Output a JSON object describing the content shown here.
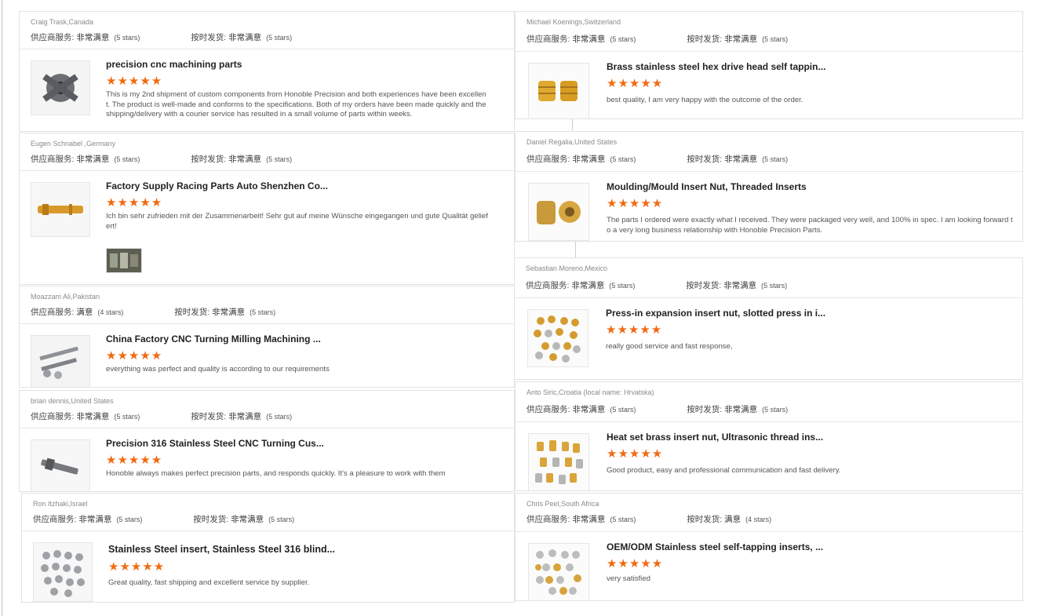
{
  "labels": {
    "service": "供应商服务:",
    "delivery": "按时发货:"
  },
  "colors": {
    "star": "#f16a12",
    "border": "#e3e3e3"
  },
  "reviews": [
    {
      "reviewer": "Craig Trask,Canada",
      "service_value": "非常满意",
      "service_stars": "(5 stars)",
      "delivery_value": "非常满意",
      "delivery_stars": "(5 stars)",
      "title": "precision cnc machining parts",
      "stars": "★★★★★",
      "comment": "This is my 2nd shipment of custom components from Honoble Precision and both experiences have been excellent.  The product is well-made and conforms to the specifications.  Both of my orders have been made quickly and the shipping/delivery with a courier service has resulted in a small volume of parts within weeks.",
      "thumb_icon": "cnc-part-icon"
    },
    {
      "reviewer": "Eugen Schnabel ,Germany",
      "service_value": "非常满意",
      "service_stars": "(5 stars)",
      "delivery_value": "非常满意",
      "delivery_stars": "(5 stars)",
      "title": "Factory Supply Racing Parts Auto Shenzhen Co...",
      "stars": "★★★★★",
      "comment": "Ich bin sehr zufrieden mit der Zusammenarbeit! Sehr gut auf meine Wünsche eingegangen und gute Qualität geliefert!",
      "thumb_icon": "brass-shaft-icon"
    },
    {
      "reviewer": "Moazzam Ali,Pakistan",
      "service_value": "满意",
      "service_stars": "(4 stars)",
      "delivery_value": "非常满意",
      "delivery_stars": "(5 stars)",
      "title": "China Factory CNC Turning Milling Machining ...",
      "stars": "★★★★★",
      "comment": "everything was perfect and quality is according to our requirements",
      "thumb_icon": "bolts-icon"
    },
    {
      "reviewer": "brian dennis,United States",
      "service_value": "非常满意",
      "service_stars": "(5 stars)",
      "delivery_value": "非常满意",
      "delivery_stars": "(5 stars)",
      "title": "Precision 316 Stainless Steel CNC Turning Cus...",
      "stars": "★★★★★",
      "comment": "Honoble always makes perfect precision parts, and responds quickly. It's a pleasure to work with them",
      "thumb_icon": "steel-pin-icon"
    },
    {
      "reviewer": "Ron Itzhaki,Israel",
      "service_value": "非常满意",
      "service_stars": "(5 stars)",
      "delivery_value": "非常满意",
      "delivery_stars": "(5 stars)",
      "title": "Stainless Steel insert, Stainless Steel 316 blind...",
      "stars": "★★★★★",
      "comment": "Great quality, fast shipping and excellent service by supplier.",
      "thumb_icon": "steel-inserts-icon"
    },
    {
      "reviewer": "Michael Koenings,Switzerland",
      "service_value": "非常满意",
      "service_stars": "(5 stars)",
      "delivery_value": "非常满意",
      "delivery_stars": "(5 stars)",
      "title": "Brass stainless steel hex drive head self tappin...",
      "stars": "★★★★★",
      "comment": "best quality, I am very happy with the outcome of the order.",
      "thumb_icon": "brass-insert-icon"
    },
    {
      "reviewer": "Daniel Regalia,United States",
      "service_value": "非常满意",
      "service_stars": "(5 stars)",
      "delivery_value": "非常满意",
      "delivery_stars": "(5 stars)",
      "title": "Moulding/Mould Insert Nut, Threaded Inserts",
      "stars": "★★★★★",
      "comment": "The parts I ordered were exactly what I received.  They were packaged very well, and 100% in spec.  I am looking forward to a very long business relationship with Honoble Precision Parts.",
      "thumb_icon": "threaded-insert-icon"
    },
    {
      "reviewer": "Sebastian Moreno,Mexico",
      "service_value": "非常满意",
      "service_stars": "(5 stars)",
      "delivery_value": "非常满意",
      "delivery_stars": "(5 stars)",
      "title": "Press-in expansion insert nut, slotted press in i...",
      "stars": "★★★★★",
      "comment": "really good service and fast response,",
      "thumb_icon": "insert-nuts-icon"
    },
    {
      "reviewer": "Anto Siric,Croatia (local name: Hrvatska)",
      "service_value": "非常满意",
      "service_stars": "(5 stars)",
      "delivery_value": "非常满意",
      "delivery_stars": "(5 stars)",
      "title": "Heat set brass insert nut, Ultrasonic thread ins...",
      "stars": "★★★★★",
      "comment": "Good product, easy and professional communication and fast delivery.",
      "thumb_icon": "heat-set-insert-icon"
    },
    {
      "reviewer": "Chris Peel,South Africa",
      "service_value": "非常满意",
      "service_stars": "(5 stars)",
      "delivery_value": "满意",
      "delivery_stars": "(4 stars)",
      "title": "OEM/ODM Stainless steel self-tapping inserts, ...",
      "stars": "★★★★★",
      "comment": "very satisfied",
      "thumb_icon": "self-tapping-insert-icon"
    }
  ]
}
